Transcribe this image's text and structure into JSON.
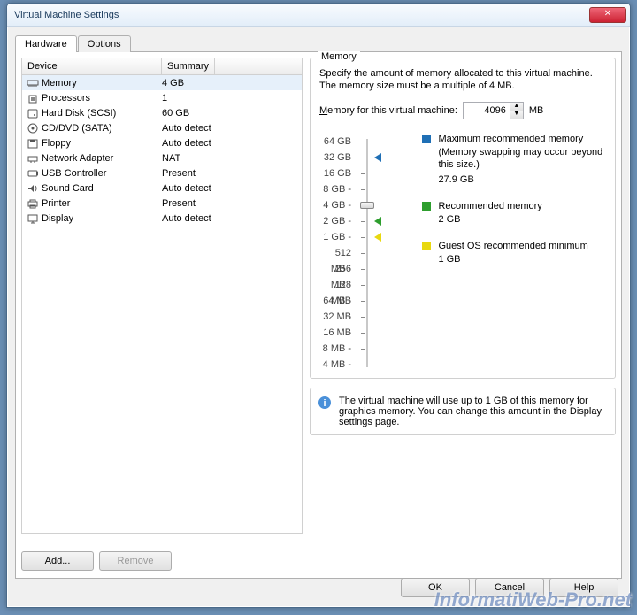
{
  "window": {
    "title": "Virtual Machine Settings"
  },
  "tabs": {
    "hardware": "Hardware",
    "options": "Options"
  },
  "table": {
    "head_device": "Device",
    "head_summary": "Summary",
    "rows": [
      {
        "name": "Memory",
        "summary": "4 GB",
        "icon": "memory",
        "selected": true
      },
      {
        "name": "Processors",
        "summary": "1",
        "icon": "cpu"
      },
      {
        "name": "Hard Disk (SCSI)",
        "summary": "60 GB",
        "icon": "disk"
      },
      {
        "name": "CD/DVD (SATA)",
        "summary": "Auto detect",
        "icon": "cd"
      },
      {
        "name": "Floppy",
        "summary": "Auto detect",
        "icon": "floppy"
      },
      {
        "name": "Network Adapter",
        "summary": "NAT",
        "icon": "net"
      },
      {
        "name": "USB Controller",
        "summary": "Present",
        "icon": "usb"
      },
      {
        "name": "Sound Card",
        "summary": "Auto detect",
        "icon": "sound"
      },
      {
        "name": "Printer",
        "summary": "Present",
        "icon": "printer"
      },
      {
        "name": "Display",
        "summary": "Auto detect",
        "icon": "display"
      }
    ]
  },
  "memory": {
    "group_title": "Memory",
    "desc": "Specify the amount of memory allocated to this virtual machine. The memory size must be a multiple of 4 MB.",
    "field_label_pre": "M",
    "field_label_mid": "emory for this virtual machine:",
    "value": "4096",
    "unit": "MB",
    "ticks": [
      "64 GB",
      "32 GB",
      "16 GB",
      "8 GB",
      "4 GB",
      "2 GB",
      "1 GB",
      "512 MB",
      "256 MB",
      "128 MB",
      "64 MB",
      "32 MB",
      "16 MB",
      "8 MB",
      "4 MB"
    ],
    "thumb_index": 4,
    "marks": {
      "max_idx": 1,
      "rec_idx": 5,
      "min_idx": 6
    },
    "legend": {
      "max": {
        "title": "Maximum recommended memory",
        "note": "(Memory swapping may occur beyond this size.)",
        "val": "27.9 GB",
        "color": "#1f6fb5"
      },
      "rec": {
        "title": "Recommended memory",
        "val": "2 GB",
        "color": "#2e9e2e"
      },
      "min": {
        "title": "Guest OS recommended minimum",
        "val": "1 GB",
        "color": "#e8d80f"
      }
    },
    "note": "The virtual machine will use up to 1 GB of this memory for graphics memory. You can change this amount in the Display settings page."
  },
  "buttons": {
    "add_pre": "A",
    "add_mid": "dd...",
    "remove_pre": "R",
    "remove_mid": "emove",
    "ok": "OK",
    "cancel": "Cancel",
    "help": "Help"
  },
  "watermark": "InformatiWeb-Pro.net"
}
